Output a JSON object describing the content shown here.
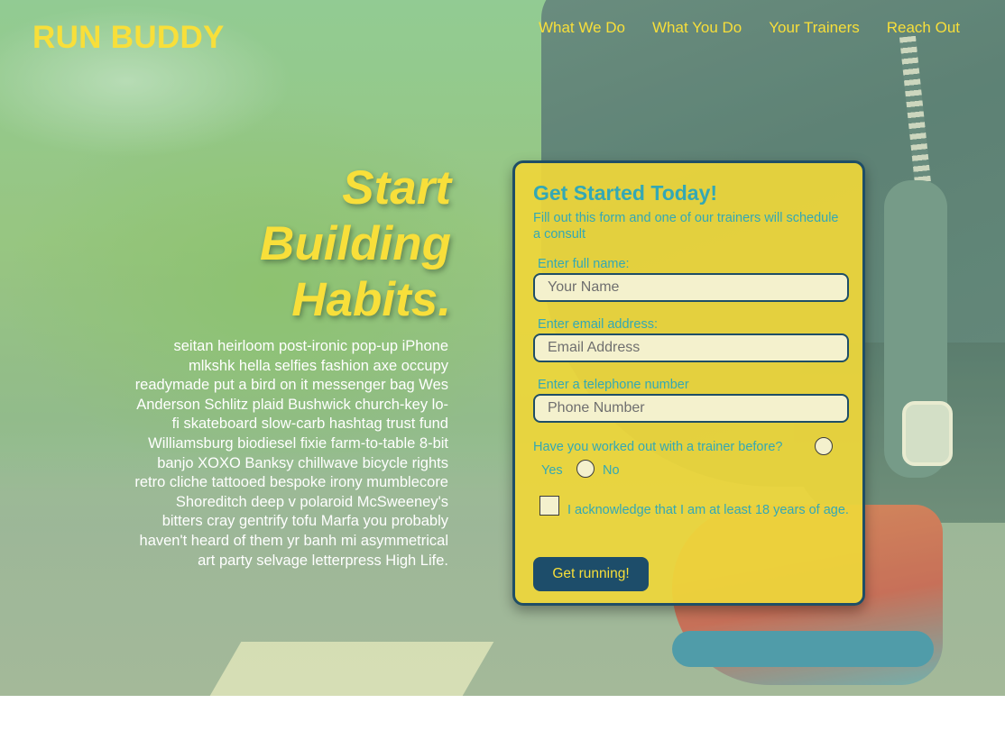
{
  "header": {
    "logo": "RUN BUDDY",
    "nav": [
      "What We Do",
      "What You Do",
      "Your Trainers",
      "Reach Out"
    ]
  },
  "hero": {
    "headline": "Start Building Habits.",
    "blurb": "seitan heirloom post-ironic pop-up iPhone mlkshk hella selfies fashion axe occupy readymade put a bird on it messenger bag Wes Anderson Schlitz plaid Bushwick church-key lo-fi skateboard slow-carb hashtag trust fund Williamsburg biodiesel fixie farm-to-table 8-bit banjo XOXO Banksy chillwave bicycle rights retro cliche tattooed bespoke irony mumblecore Shoreditch deep v polaroid McSweeney's bitters cray gentrify tofu Marfa you probably haven't heard of them yr banh mi asymmetrical art party selvage letterpress High Life."
  },
  "form": {
    "title": "Get Started Today!",
    "subtitle": "Fill out this form and one of our trainers will schedule a consult",
    "fields": [
      {
        "label": "Enter full name:",
        "placeholder": "Your Name",
        "value": ""
      },
      {
        "label": "Enter email address:",
        "placeholder": "Email Address",
        "value": ""
      },
      {
        "label": "Enter a telephone number",
        "placeholder": "Phone Number",
        "value": ""
      }
    ],
    "trainer_question": "Have you worked out with a trainer before?",
    "options": [
      "Yes",
      "No"
    ],
    "acknowledge": "I acknowledge that I am at least 18 years of age.",
    "submit_label": "Get running!"
  },
  "colors": {
    "brand_yellow": "#f8df3a",
    "teal_text": "#33a8b5",
    "navy": "#1d4d6a"
  }
}
